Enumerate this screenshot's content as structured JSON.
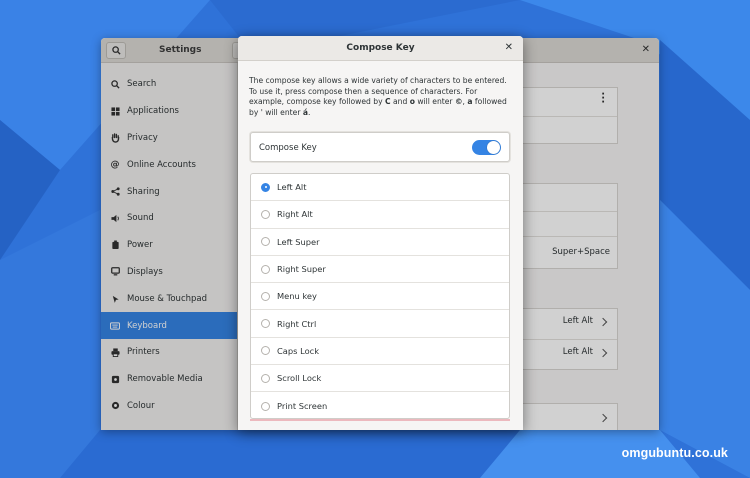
{
  "settings": {
    "title": "Settings",
    "sidebar": [
      {
        "label": "Search",
        "icon": "search-icon"
      },
      {
        "label": "Applications",
        "icon": "applications-icon"
      },
      {
        "label": "Privacy",
        "icon": "hand-icon"
      },
      {
        "label": "Online Accounts",
        "icon": "at-icon"
      },
      {
        "label": "Sharing",
        "icon": "share-icon"
      },
      {
        "label": "Sound",
        "icon": "speaker-icon"
      },
      {
        "label": "Power",
        "icon": "power-icon"
      },
      {
        "label": "Displays",
        "icon": "display-icon"
      },
      {
        "label": "Mouse & Touchpad",
        "icon": "mouse-icon"
      },
      {
        "label": "Keyboard",
        "icon": "keyboard-icon",
        "active": true
      },
      {
        "label": "Printers",
        "icon": "printer-icon"
      },
      {
        "label": "Removable Media",
        "icon": "media-icon"
      },
      {
        "label": "Colour",
        "icon": "colour-icon"
      }
    ],
    "content": {
      "shortcut_value": "Super+Space",
      "row1_value": "Left Alt",
      "row2_value": "Left Alt"
    }
  },
  "dialog": {
    "title": "Compose Key",
    "desc_part1": "The compose key allows a wide variety of characters to be entered. To use it, press compose then a sequence of characters.  For example, compose key followed by ",
    "desc_c": "C",
    "desc_and": " and ",
    "desc_o": "o",
    "desc_will": " will enter ",
    "desc_copy": "©",
    "desc_comma": ", ",
    "desc_a": "a",
    "desc_followed": " followed by ' will enter ",
    "desc_aacute": "á",
    "desc_end": ".",
    "toggle_label": "Compose Key",
    "toggle_on": true,
    "options": [
      {
        "label": "Left Alt",
        "checked": true
      },
      {
        "label": "Right Alt",
        "checked": false
      },
      {
        "label": "Left Super",
        "checked": false
      },
      {
        "label": "Right Super",
        "checked": false
      },
      {
        "label": "Menu key",
        "checked": false
      },
      {
        "label": "Right Ctrl",
        "checked": false
      },
      {
        "label": "Caps Lock",
        "checked": false
      },
      {
        "label": "Scroll Lock",
        "checked": false
      },
      {
        "label": "Print Screen",
        "checked": false
      }
    ]
  },
  "watermark": "omgubuntu.co.uk",
  "colors": {
    "accent": "#3584e4",
    "wallpaper": "#2a6fd6"
  }
}
